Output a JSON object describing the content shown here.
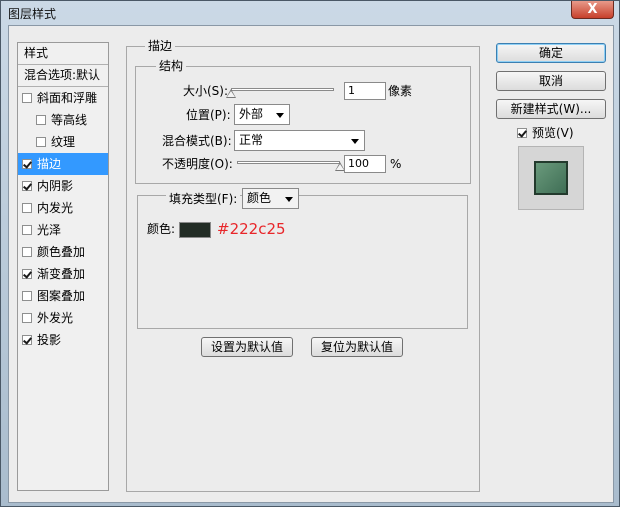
{
  "window": {
    "title": "图层样式",
    "close_label": "X"
  },
  "stylelist": {
    "header": "样式",
    "blend_item": "混合选项:默认",
    "items": [
      {
        "label": "斜面和浮雕",
        "checked": false
      },
      {
        "label": "等高线",
        "checked": false
      },
      {
        "label": "纹理",
        "checked": false
      },
      {
        "label": "描边",
        "checked": true
      },
      {
        "label": "内阴影",
        "checked": true
      },
      {
        "label": "内发光",
        "checked": false
      },
      {
        "label": "光泽",
        "checked": false
      },
      {
        "label": "颜色叠加",
        "checked": false
      },
      {
        "label": "渐变叠加",
        "checked": true
      },
      {
        "label": "图案叠加",
        "checked": false
      },
      {
        "label": "外发光",
        "checked": false
      },
      {
        "label": "投影",
        "checked": true
      }
    ]
  },
  "stroke": {
    "group_title": "描边",
    "structure_title": "结构",
    "size_label": "大小(S):",
    "size_value": "1",
    "size_unit": "像素",
    "size_slider_value": 1,
    "position_label": "位置(P):",
    "position_value": "外部",
    "blend_label": "混合模式(B):",
    "blend_value": "正常",
    "opacity_label": "不透明度(O):",
    "opacity_value": "100",
    "opacity_unit": "%",
    "opacity_slider_percent": 100,
    "fill_type_label": "填充类型(F):",
    "fill_type_value": "颜色",
    "color_label": "颜色:",
    "color_value": "#222c25",
    "color_hex_text": "#222c25"
  },
  "buttons": {
    "set_default": "设置为默认值",
    "reset_default": "复位为默认值",
    "ok": "确定",
    "cancel": "取消",
    "new_style": "新建样式(W)..."
  },
  "preview": {
    "label": "预览(V)",
    "checked": true
  }
}
